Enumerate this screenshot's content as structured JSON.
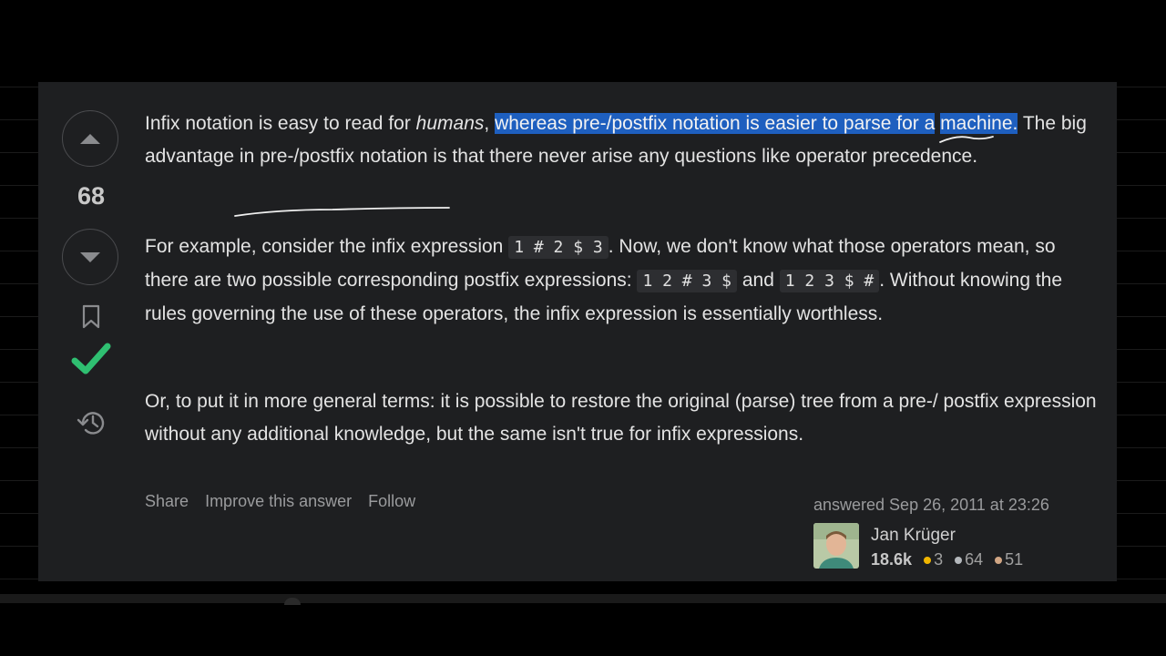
{
  "post": {
    "score": "68",
    "p1": {
      "text1": "Infix notation is easy to read for ",
      "text2": "humans",
      "text3": ", ",
      "highlight1": "whereas pre-/postfix notation is easier to parse for a",
      "highlight2": "machine.",
      "text4": " The big advantage in pre-/postfix notation is that there never arise any questions like operator precedence."
    },
    "p2": {
      "text1": "For example, consider the infix expression ",
      "code1": "1 # 2 $ 3",
      "text2": ". Now, we don't know what those operators mean, so there are two possible corresponding postfix expressions: ",
      "code2": "1 2 # 3 $",
      "text3": " and ",
      "code3": "1 2 3 $ #",
      "text4": ". Without knowing the rules governing the use of these operators, the infix expression is essentially worthless."
    },
    "p3": "Or, to put it in more general terms: it is possible to restore the original (parse) tree from a pre-/ postfix expression without any additional knowledge, but the same isn't true for infix expressions."
  },
  "actions": {
    "share": "Share",
    "improve": "Improve this answer",
    "follow": "Follow"
  },
  "author": {
    "answered": "answered Sep 26, 2011 at 23:26",
    "name": "Jan Krüger",
    "reputation": "18.6k",
    "gold": "3",
    "silver": "64",
    "bronze": "51"
  },
  "icons": {
    "upvote": "triangle-up-icon",
    "downvote": "triangle-down-icon",
    "bookmark": "bookmark-icon",
    "accepted": "checkmark-icon",
    "history": "history-icon"
  },
  "colors": {
    "highlight": "#1e5fbf",
    "accepted": "#2fbf71",
    "gold": "#f1b600",
    "silver": "#b4b8bc",
    "bronze": "#d1a684"
  }
}
